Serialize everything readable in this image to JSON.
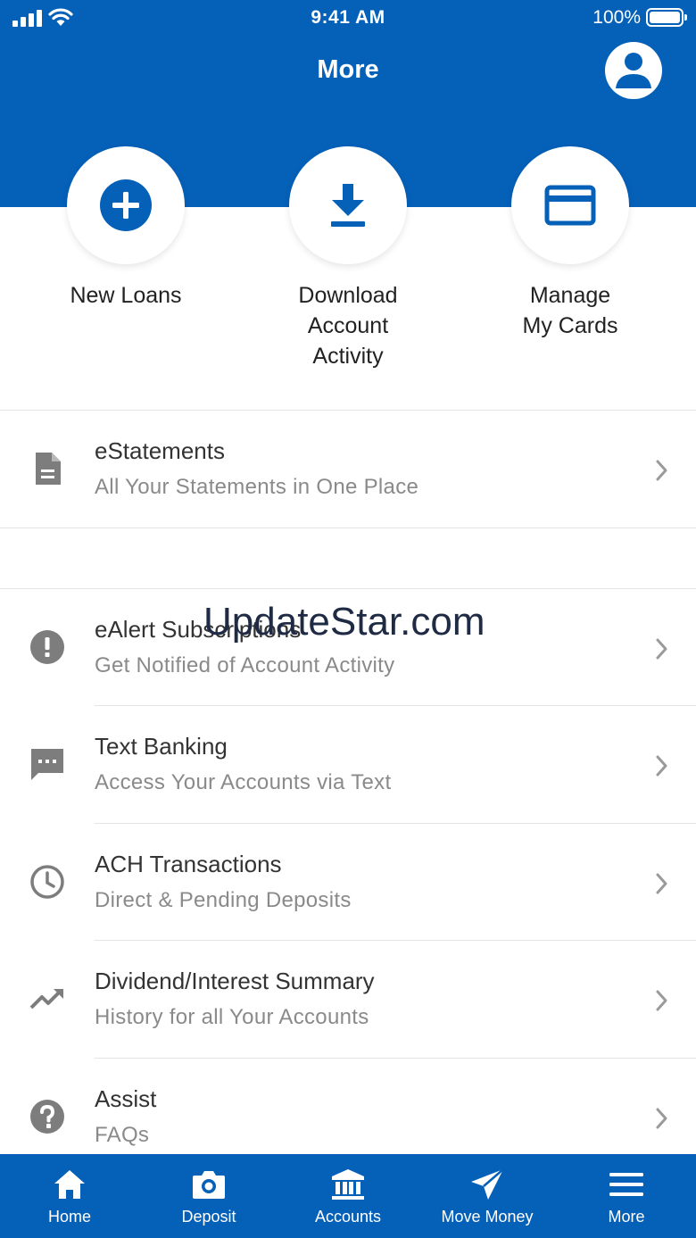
{
  "status_bar": {
    "time": "9:41 AM",
    "battery": "100%"
  },
  "header": {
    "title": "More"
  },
  "quick_actions": [
    {
      "icon": "add-circle-icon",
      "label_lines": [
        "New Loans"
      ]
    },
    {
      "icon": "download-icon",
      "label_lines": [
        "Download",
        "Account",
        "Activity"
      ]
    },
    {
      "icon": "credit-card-icon",
      "label_lines": [
        "Manage",
        "My Cards"
      ]
    }
  ],
  "menu": [
    {
      "icon": "document-icon",
      "title": "eStatements",
      "subtitle": "All Your Statements in One Place"
    },
    {
      "icon": "alert-icon",
      "title": "eAlert Subscriptions",
      "subtitle": "Get Notified of Account Activity"
    },
    {
      "icon": "chat-icon",
      "title": "Text Banking",
      "subtitle": "Access Your Accounts via Text"
    },
    {
      "icon": "clock-icon",
      "title": "ACH Transactions",
      "subtitle": "Direct & Pending Deposits"
    },
    {
      "icon": "trending-up-icon",
      "title": "Dividend/Interest Summary",
      "subtitle": "History for all Your Accounts"
    },
    {
      "icon": "help-icon",
      "title": "Assist",
      "subtitle": "FAQs"
    }
  ],
  "watermark": "UpdateStar.com",
  "tabbar": {
    "items": [
      {
        "icon": "home-icon",
        "label": "Home"
      },
      {
        "icon": "camera-icon",
        "label": "Deposit"
      },
      {
        "icon": "bank-icon",
        "label": "Accounts"
      },
      {
        "icon": "send-icon",
        "label": "Move Money"
      },
      {
        "icon": "menu-icon",
        "label": "More"
      }
    ],
    "active": "More"
  },
  "colors": {
    "brand": "#0560b8",
    "icon_gray": "#7d7d7d",
    "subtitle_gray": "#8a8a8a",
    "divider": "#e4e4e4"
  }
}
